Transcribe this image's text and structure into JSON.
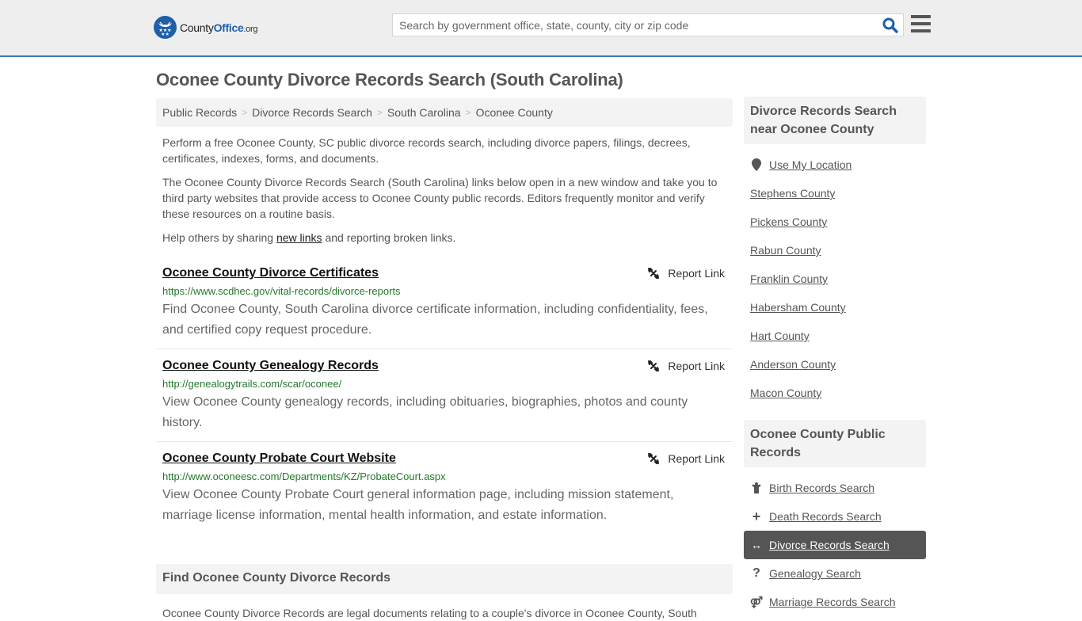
{
  "header": {
    "logo": {
      "prefix": "County",
      "brand": "Office",
      "suffix": ".org"
    },
    "search": {
      "placeholder": "Search by government office, state, county, city or zip code",
      "value": ""
    },
    "icons": {
      "search": "search-icon",
      "menu": "hamburger-menu-icon"
    }
  },
  "page": {
    "title": "Oconee County Divorce Records Search (South Carolina)"
  },
  "breadcrumb": [
    {
      "label": "Public Records"
    },
    {
      "label": "Divorce Records Search"
    },
    {
      "label": "South Carolina"
    },
    {
      "label": "Oconee County"
    }
  ],
  "intro": {
    "p1": "Perform a free Oconee County, SC public divorce records search, including divorce papers, filings, decrees, certificates, indexes, forms, and documents.",
    "p2": "The Oconee County Divorce Records Search (South Carolina) links below open in a new window and take you to third party websites that provide access to Oconee County public records. Editors frequently monitor and verify these resources on a routine basis.",
    "p3_before": "Help others by sharing ",
    "p3_link": "new links",
    "p3_after": " and reporting broken links."
  },
  "links": [
    {
      "title": "Oconee County Divorce Certificates",
      "url": "https://www.scdhec.gov/vital-records/divorce-reports",
      "description": "Find Oconee County, South Carolina divorce certificate information, including confidentiality, fees, and certified copy request procedure.",
      "report_label": "Report Link"
    },
    {
      "title": "Oconee County Genealogy Records",
      "url": "http://genealogytrails.com/scar/oconee/",
      "description": "View Oconee County genealogy records, including obituaries, biographies, photos and county history.",
      "report_label": "Report Link"
    },
    {
      "title": "Oconee County Probate Court Website",
      "url": "http://www.oconeesc.com/Departments/KZ/ProbateCourt.aspx",
      "description": "View Oconee County Probate Court general information page, including mission statement, marriage license information, mental health information, and estate information.",
      "report_label": "Report Link"
    }
  ],
  "find_section": {
    "heading": "Find Oconee County Divorce Records",
    "text": "Oconee County Divorce Records are legal documents relating to a couple's divorce in Oconee County, South"
  },
  "sidebar": {
    "nearby": {
      "heading": "Divorce Records Search near Oconee County",
      "use_location": "Use My Location",
      "items": [
        {
          "label": "Stephens County"
        },
        {
          "label": "Pickens County"
        },
        {
          "label": "Rabun County"
        },
        {
          "label": "Franklin County"
        },
        {
          "label": "Habersham County"
        },
        {
          "label": "Hart County"
        },
        {
          "label": "Anderson County"
        },
        {
          "label": "Macon County"
        }
      ]
    },
    "public_records": {
      "heading": "Oconee County Public Records",
      "items": [
        {
          "label": "Birth Records Search",
          "icon": "child-icon",
          "active": false
        },
        {
          "label": "Death Records Search",
          "icon": "plus-icon",
          "active": false
        },
        {
          "label": "Divorce Records Search",
          "icon": "arrows-horizontal-icon",
          "active": true
        },
        {
          "label": "Genealogy Search",
          "icon": "question-icon",
          "active": false
        },
        {
          "label": "Marriage Records Search",
          "icon": "venus-mars-icon",
          "active": false
        }
      ]
    }
  },
  "colors": {
    "brand_blue": "#1f5fa8",
    "header_border": "#3a7cb0",
    "url_green": "#24792b",
    "active_bg": "#555555"
  }
}
